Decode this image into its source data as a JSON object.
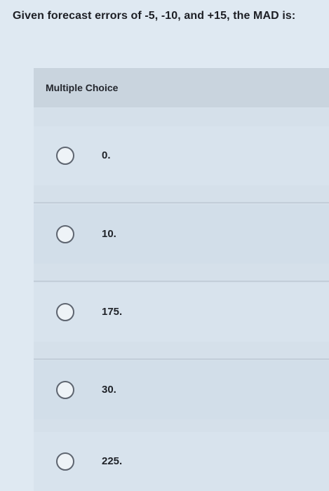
{
  "question": "Given forecast errors of -5, -10, and +15, the MAD is:",
  "section_label": "Multiple Choice",
  "options": [
    {
      "label": "0."
    },
    {
      "label": "10."
    },
    {
      "label": "175."
    },
    {
      "label": "30."
    },
    {
      "label": "225."
    }
  ],
  "colors": {
    "background": "#dfe9f2",
    "panel": "#d5e0ea",
    "header": "#c9d4de",
    "radio_border": "#5e6570"
  },
  "icons": {
    "radio": "radio-circle-icon"
  }
}
